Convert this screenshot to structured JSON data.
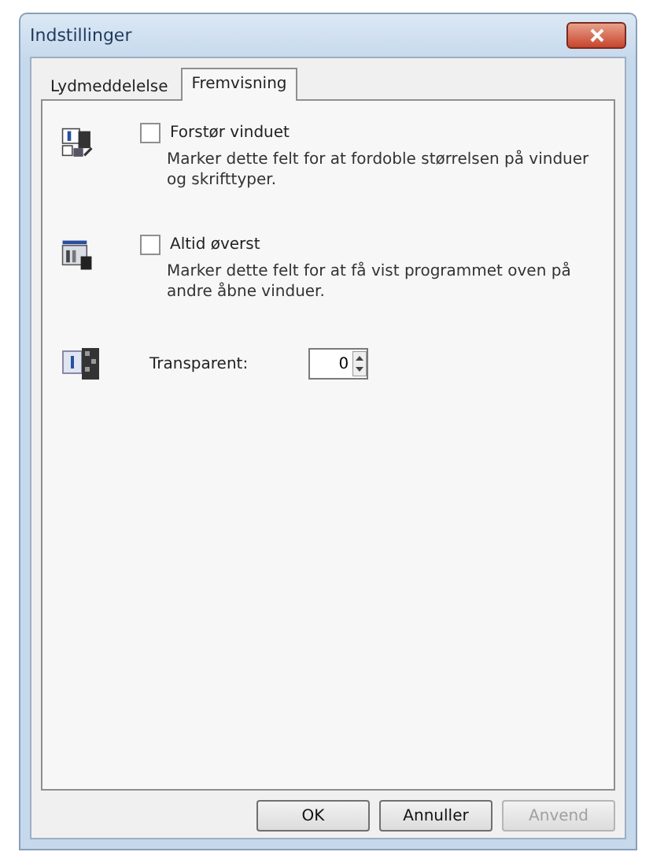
{
  "window": {
    "title": "Indstillinger"
  },
  "tabs": [
    {
      "label": "Lydmeddelelse",
      "selected": false
    },
    {
      "label": "Fremvisning",
      "selected": true
    }
  ],
  "options": [
    {
      "kind": "checkbox",
      "label": "Forstør vinduet",
      "checked": false,
      "description": "Marker dette felt for at fordoble størrelsen på vinduer og skrifttyper."
    },
    {
      "kind": "checkbox",
      "label": "Altid øverst",
      "checked": false,
      "description": "Marker dette felt for at få vist programmet oven på andre åbne vinduer."
    },
    {
      "kind": "spinner",
      "label": "Transparent:",
      "value": "0"
    }
  ],
  "buttons": [
    {
      "label": "OK",
      "disabled": false
    },
    {
      "label": "Annuller",
      "disabled": false
    },
    {
      "label": "Anvend",
      "disabled": true
    }
  ]
}
